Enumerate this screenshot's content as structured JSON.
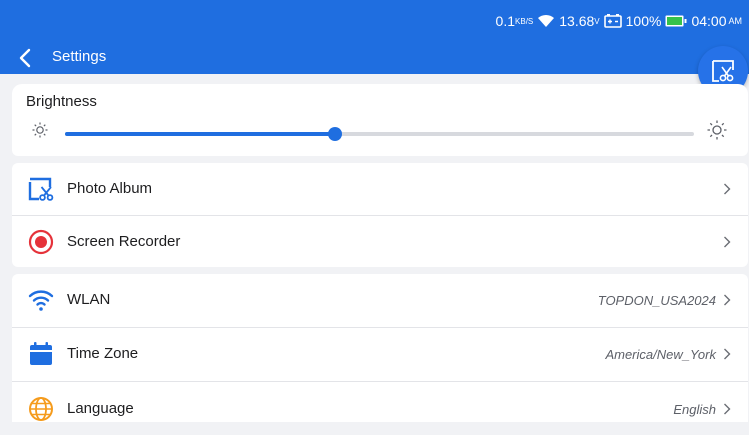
{
  "status_bar": {
    "net_speed": "0.1",
    "net_unit": "KB/S",
    "voltage": "13.68",
    "voltage_unit": "V",
    "battery_percent": "100%",
    "time": "04:00",
    "ampm": "AM"
  },
  "header": {
    "title": "Settings"
  },
  "brightness": {
    "label": "Brightness",
    "level": 0.43
  },
  "tools": [
    {
      "label": "Photo Album",
      "icon": "photo-album-icon"
    },
    {
      "label": "Screen Recorder",
      "icon": "record-icon"
    }
  ],
  "network": [
    {
      "label": "WLAN",
      "value": "TOPDON_USA2024",
      "icon": "wifi-icon"
    },
    {
      "label": "Time Zone",
      "value": "America/New_York",
      "icon": "calendar-icon"
    },
    {
      "label": "Language",
      "value": "English",
      "icon": "globe-icon"
    }
  ],
  "colors": {
    "accent": "#1f6ee0",
    "record_red": "#e5323a",
    "language_orange": "#f59b1c"
  }
}
